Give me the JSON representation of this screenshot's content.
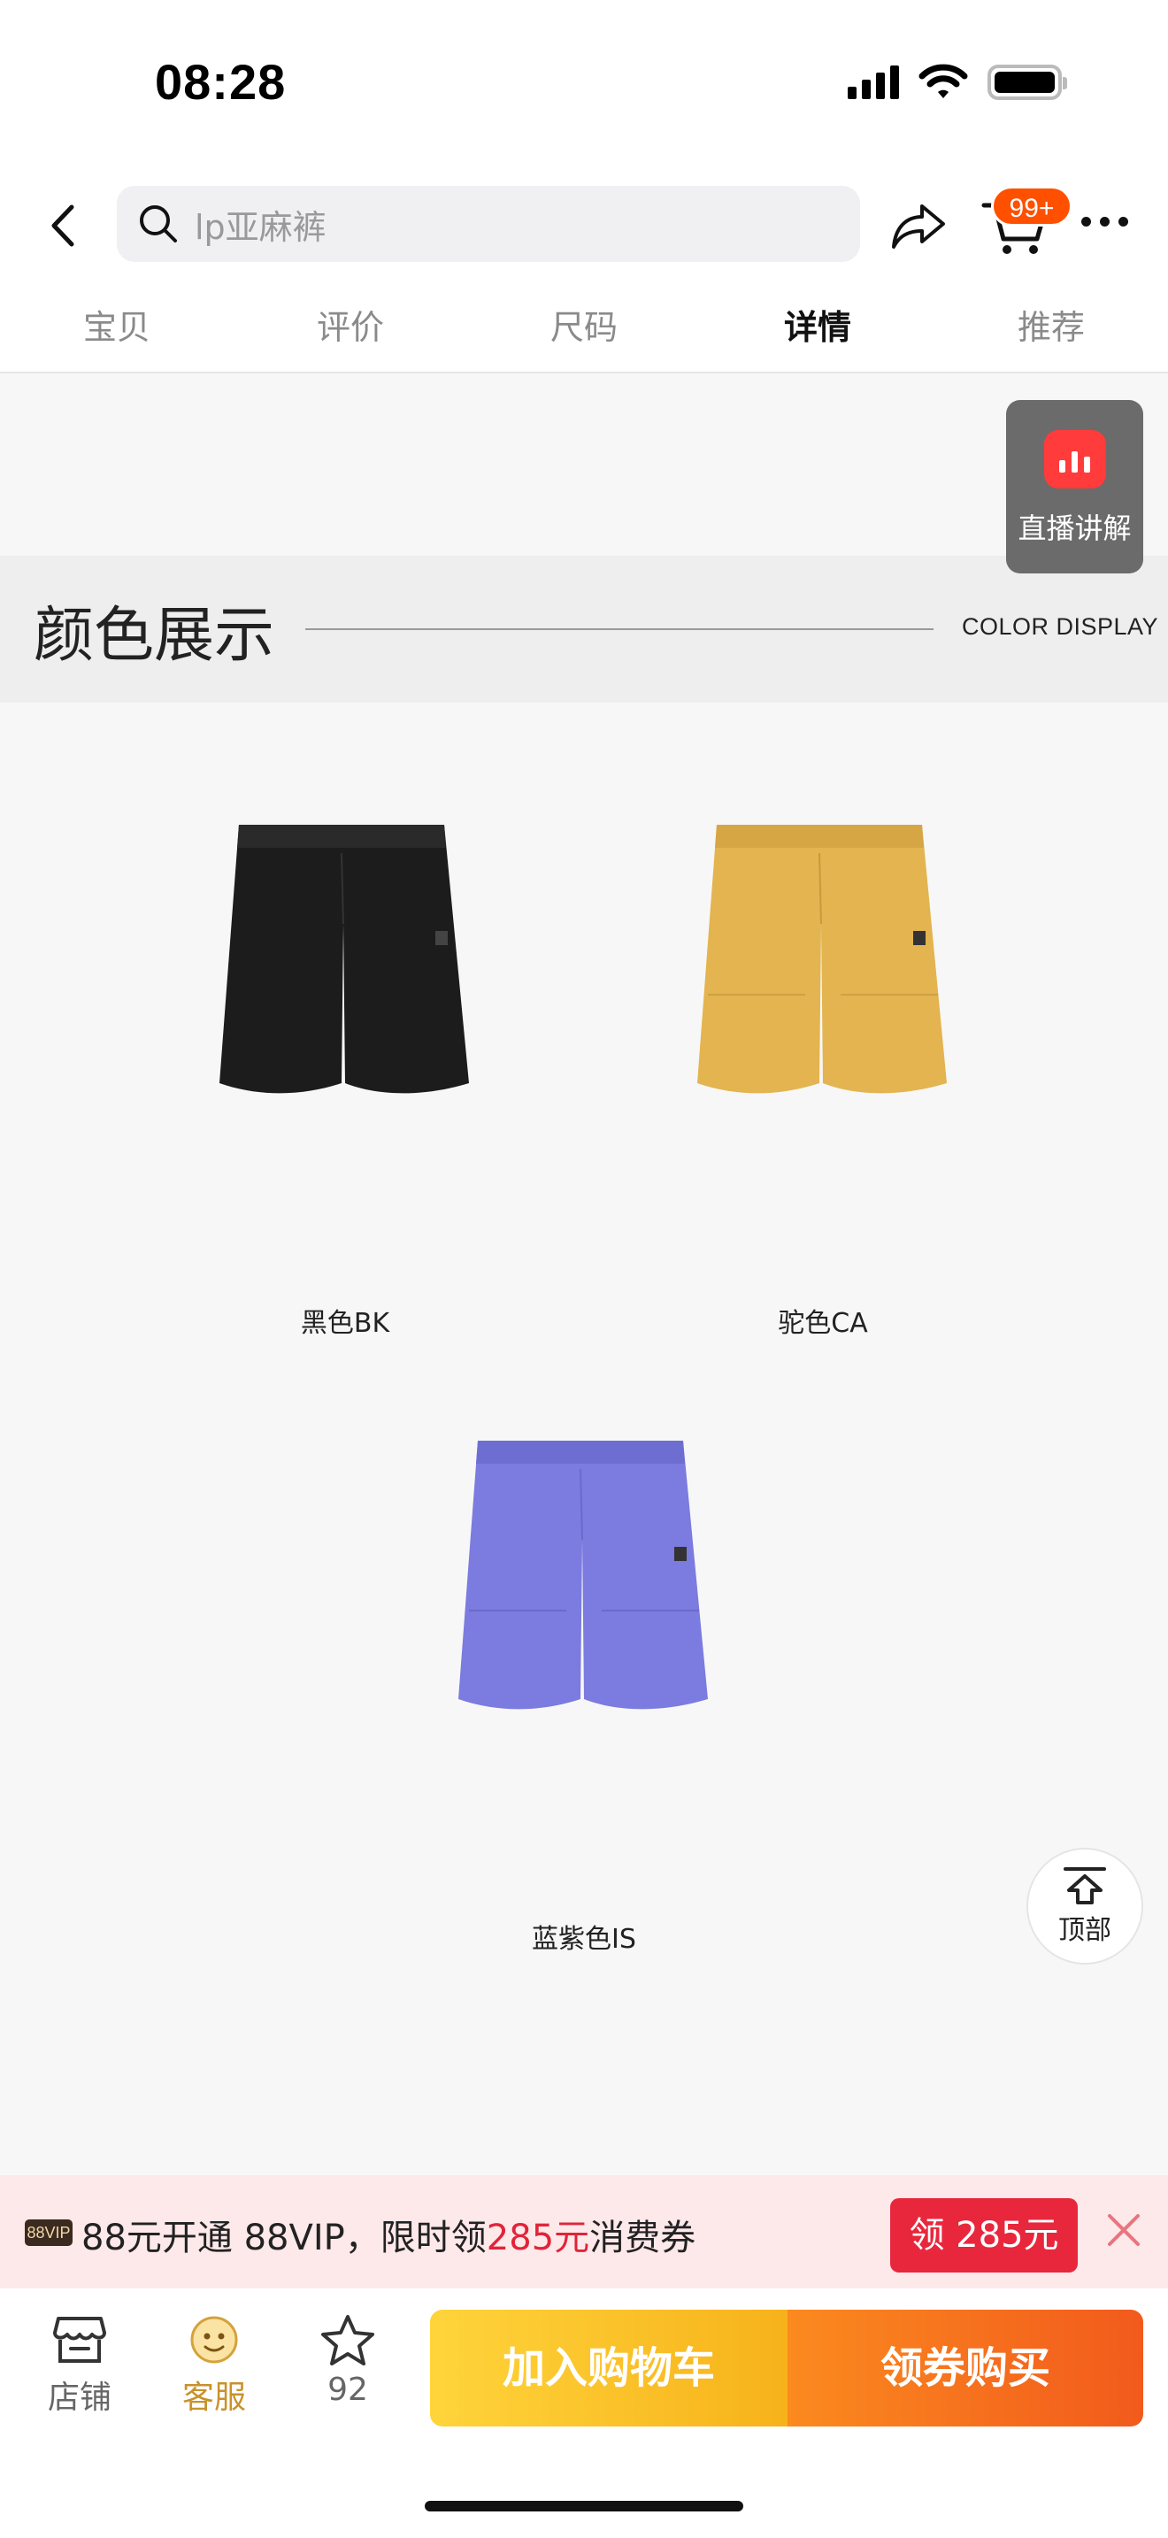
{
  "status_bar": {
    "time": "08:28"
  },
  "header": {
    "search_placeholder": "lp亚麻裤",
    "cart_badge": "99+"
  },
  "tabs": [
    {
      "label": "宝贝",
      "active": false
    },
    {
      "label": "评价",
      "active": false
    },
    {
      "label": "尺码",
      "active": false
    },
    {
      "label": "详情",
      "active": true
    },
    {
      "label": "推荐",
      "active": false
    }
  ],
  "live": {
    "label": "直播讲解"
  },
  "color_section": {
    "title_cn": "颜色展示",
    "title_en": "COLOR DISPLAY",
    "products": [
      {
        "caption": "黑色BK",
        "color": "#1c1c1c"
      },
      {
        "caption": "驼色CA",
        "color": "#e3b44f"
      },
      {
        "caption": "蓝紫色IS",
        "color": "#7b7be0"
      }
    ]
  },
  "back_to_top": {
    "label": "顶部"
  },
  "vip_banner": {
    "badge": "88VIP",
    "text_prefix": "88元开通 88VIP，限时领",
    "text_amount": "285元",
    "text_suffix": "消费券",
    "button": "领 285元"
  },
  "bottom_bar": {
    "store_label": "店铺",
    "service_label": "客服",
    "favorite_count": "92",
    "add_to_cart": "加入购物车",
    "buy_coupon": "领券购买"
  },
  "colors": {
    "accent_orange": "#ff5000",
    "vip_red": "#e0243a",
    "cart_yellow": "#f7b21a",
    "buy_orange": "#f25a1c"
  }
}
